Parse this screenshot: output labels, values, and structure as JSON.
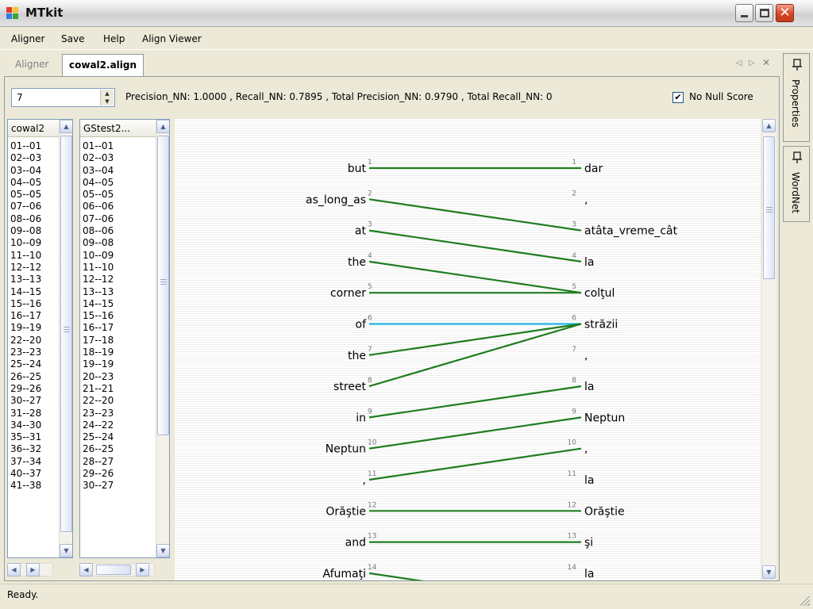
{
  "window": {
    "title": "MTkit"
  },
  "menu": [
    "Aligner",
    "Save",
    "Help",
    "Align Viewer"
  ],
  "tabs": {
    "inactive": "Aligner",
    "active": "cowal2.align",
    "nav": [
      "◁",
      "▷",
      "✕"
    ]
  },
  "spinner": {
    "value": "7"
  },
  "stats": "Precision_NN: 1.0000  ,  Recall_NN: 0.7895  ,  Total Precision_NN: 0.9790  ,  Total Recall_NN: 0",
  "no_null_score": {
    "label": "No Null Score",
    "checked": true,
    "mark": "✔"
  },
  "list1": {
    "header": "cowal2",
    "items": [
      "01--01",
      "02--03",
      "03--04",
      "04--05",
      "05--05",
      "07--06",
      "08--06",
      "09--08",
      "10--09",
      "11--10",
      "12--12",
      "13--13",
      "14--15",
      "15--16",
      "16--17",
      "19--19",
      "22--20",
      "23--23",
      "25--24",
      "26--25",
      "29--26",
      "30--27",
      "31--28",
      "34--30",
      "35--31",
      "36--32",
      "37--34",
      "40--37",
      "41--38"
    ]
  },
  "list2": {
    "header": "GStest2...",
    "items": [
      "01--01",
      "02--03",
      "03--04",
      "04--05",
      "05--05",
      "06--06",
      "07--06",
      "08--06",
      "09--08",
      "10--09",
      "11--10",
      "12--12",
      "13--13",
      "14--15",
      "15--16",
      "16--17",
      "17--18",
      "18--19",
      "19--19",
      "20--23",
      "21--21",
      "22--20",
      "23--23",
      "24--22",
      "25--24",
      "26--25",
      "28--27",
      "29--26",
      "30--27"
    ]
  },
  "side_tabs": [
    "Properties",
    "WordNet"
  ],
  "alignment": {
    "source": [
      {
        "i": 1,
        "w": "but"
      },
      {
        "i": 2,
        "w": "as_long_as"
      },
      {
        "i": 3,
        "w": "at"
      },
      {
        "i": 4,
        "w": "the"
      },
      {
        "i": 5,
        "w": "corner"
      },
      {
        "i": 6,
        "w": "of"
      },
      {
        "i": 7,
        "w": "the"
      },
      {
        "i": 8,
        "w": "street"
      },
      {
        "i": 9,
        "w": "in"
      },
      {
        "i": 10,
        "w": "Neptun"
      },
      {
        "i": 11,
        "w": ","
      },
      {
        "i": 12,
        "w": "Orăştie"
      },
      {
        "i": 13,
        "w": "and"
      },
      {
        "i": 14,
        "w": "Afumaţi"
      }
    ],
    "target": [
      {
        "i": 1,
        "w": "dar"
      },
      {
        "i": 2,
        "w": ","
      },
      {
        "i": 3,
        "w": "atâta_vreme_cât"
      },
      {
        "i": 4,
        "w": "la"
      },
      {
        "i": 5,
        "w": "colţul"
      },
      {
        "i": 6,
        "w": "străzii"
      },
      {
        "i": 7,
        "w": ","
      },
      {
        "i": 8,
        "w": "la"
      },
      {
        "i": 9,
        "w": "Neptun"
      },
      {
        "i": 10,
        "w": ","
      },
      {
        "i": 11,
        "w": "la"
      },
      {
        "i": 12,
        "w": "Orăştie"
      },
      {
        "i": 13,
        "w": "şi"
      },
      {
        "i": 14,
        "w": "la"
      }
    ],
    "links": [
      {
        "s": 1,
        "t": 1,
        "c": "#1e7d1e"
      },
      {
        "s": 2,
        "t": 3,
        "c": "#1e7d1e"
      },
      {
        "s": 3,
        "t": 4,
        "c": "#1e7d1e"
      },
      {
        "s": 4,
        "t": 5,
        "c": "#1e7d1e"
      },
      {
        "s": 5,
        "t": 5,
        "c": "#1e7d1e"
      },
      {
        "s": 6,
        "t": 6,
        "c": "#29b6e8"
      },
      {
        "s": 7,
        "t": 6,
        "c": "#1e7d1e"
      },
      {
        "s": 8,
        "t": 6,
        "c": "#1e7d1e"
      },
      {
        "s": 9,
        "t": 8,
        "c": "#1e7d1e"
      },
      {
        "s": 10,
        "t": 9,
        "c": "#1e7d1e"
      },
      {
        "s": 11,
        "t": 10,
        "c": "#1e7d1e"
      },
      {
        "s": 12,
        "t": 12,
        "c": "#1e7d1e"
      },
      {
        "s": 13,
        "t": 13,
        "c": "#1e7d1e"
      },
      {
        "s": 14,
        "t": 15,
        "c": "#1e7d1e"
      }
    ]
  },
  "status": "Ready."
}
